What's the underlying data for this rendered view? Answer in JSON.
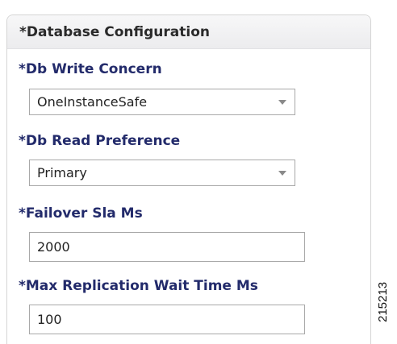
{
  "panel": {
    "title": "*Database Configuration"
  },
  "fields": {
    "write_concern": {
      "label": "*Db Write Concern",
      "value": "OneInstanceSafe"
    },
    "read_preference": {
      "label": "*Db Read Preference",
      "value": "Primary"
    },
    "failover_sla": {
      "label": "*Failover Sla Ms",
      "value": "2000"
    },
    "max_replication_wait": {
      "label": "*Max Replication Wait Time Ms",
      "value": "100"
    }
  },
  "figure_id": "215213",
  "icons": {
    "dropdown": "chevron-down-icon"
  },
  "colors": {
    "label": "#232b6b",
    "header_bg": "#ececee",
    "border": "#a8a8a8"
  }
}
